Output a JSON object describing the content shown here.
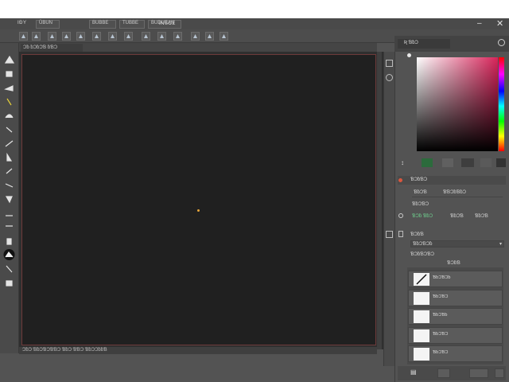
{
  "menu": {
    "items": [
      "IÐY",
      "ÜBUN",
      "BUBBE",
      "TUBBE",
      "BUDUEAN",
      "INSCE"
    ]
  },
  "options_bar": {
    "icons": [
      "home-icon",
      "frame-icon",
      "arrow-icon",
      "move-icon",
      "select-icon",
      "lasso-icon",
      "transform-icon",
      "warp-icon",
      "target-icon",
      "circle-icon",
      "record-icon",
      "align-icon",
      "distribute-icon",
      "arrange-icon"
    ]
  },
  "document": {
    "tab_label": "Ɔƀ ƀƆƀƆƁ ƀƁƆ",
    "status_text": "ƆƀƆ ƁƀƆƁƆƁƁƆ ƁƀƆ ƁƁƆ ƁƀƆƆƀƀƁ",
    "accent_dot_color": "#e7a53a"
  },
  "tools": [
    "move-icon",
    "lasso-icon",
    "crop-icon",
    "eyedropper-icon",
    "brush-icon",
    "stamp-icon",
    "eraser-icon",
    "blur-icon",
    "dodge-icon",
    "pen-icon",
    "type-icon",
    "path-icon",
    "shape-icon",
    "hand-icon",
    "zoom-icon",
    "color-icon",
    "mask-icon"
  ],
  "panel": {
    "header_label": "Ʀ ƁƀƆ",
    "properties": {
      "title": "ƁƆƀƁƆ",
      "row1_left": "ƁƀƆƁ",
      "row1_right": "ƁƁƆƀƁƀƆ",
      "row2_left": "ƁƀƆƁƆ",
      "row3_left": "ƁƆƀ ƁƀƆ",
      "row3_mid": "ƁƀƆƁ",
      "row3_right": "ƁƀƆƁ"
    },
    "adjust": {
      "row1": "ƁƆƀƁ",
      "row2": "ƁƀƆƁƆƀ",
      "row3": "ƁƆƀƁƆƁƆ",
      "subheader": "ƁƆƀƁ"
    },
    "layers": [
      {
        "name": "ƁƀƆƁƆƀ"
      },
      {
        "name": "ƁƀƆƁƆ"
      },
      {
        "name": "ƁƀƆƁƀ"
      },
      {
        "name": "ƁƀƆƁƆ"
      },
      {
        "name": "ƁƀƆƁƆ"
      }
    ],
    "swatches": [
      "#2c6b3c",
      "#606060",
      "#3e3e3e",
      "#5a5a5a",
      "#333333"
    ]
  }
}
